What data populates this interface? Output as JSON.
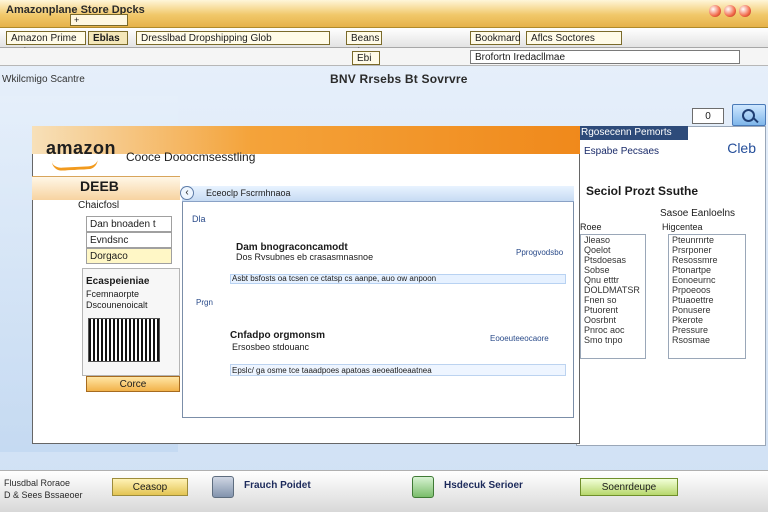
{
  "top": {
    "title": "Amazonplane Store Dpcks",
    "tabs_box": "+",
    "right_icons": [
      "close",
      "minimize",
      "maximize"
    ]
  },
  "toolbar": {
    "left_pill": "Amazon Prime Dok",
    "middle_pill": "Dresslbad Dropshipping Glob",
    "fb_pill": "Eblas",
    "status_pill": "Beans Sbout",
    "bookmark_pill": "Bookmard",
    "right_text": "Aflcs Soctores"
  },
  "address": {
    "label": "Ebi",
    "input_value": "Brofortn Iredacllmae"
  },
  "left": {
    "sidebar_label": "Wkilcmigo Scantre"
  },
  "headline": {
    "text": "BNV Rrsebs Bt Sovrvre"
  },
  "amazon": {
    "logo": "amazon",
    "tagline": "Cooce Dooocmsesstling",
    "section_label": "DEEB",
    "subtitle": "Chaicfosl",
    "field_1": "Dan bnoaden t",
    "field_2": "Evndsnc",
    "field_3": "Dorgaco",
    "card_title": "Ecaspeieniae",
    "card_line_1": "Fcemnaorpte",
    "card_line_2": "Dscounenoicalt",
    "card_btn": "Corce"
  },
  "popup": {
    "title": "Eceoclp Fscrmhnaoa",
    "left_mini": "Dla",
    "row_title": "Dam bnograconcamodt",
    "row_sub": "Dos Rvsubnes eb crasasmnasnoe",
    "row_text": "Asbt bsfosts oa tcsen ce ctatsp cs aanpe, auo ow anpoon",
    "row_note": "Pprogvodsbo",
    "side_label": "Prgn",
    "block2_title": "Cnfadpo orgmonsm",
    "block2_sub": "Ersosbeo stdouanc",
    "block2_row": "Epslc/ ga osme tce taaadpoes apatoas aeoeatloeaatnea",
    "row_note2": "Eooeuteeocaore"
  },
  "right": {
    "header": "Rgosecenn Pemorts",
    "title": "Espabe Pecsaes",
    "link": "Cleb",
    "section_title": "Seciol Prozt Ssuthe",
    "search_title": "Sasoe Eanloelns",
    "col_left_title": "Roee",
    "col_right_title": "Higcentea",
    "col_left_items": [
      "Jleaso",
      "Qoelot",
      "Ptsdoesas",
      "Sobse",
      "Qnu etttr",
      "DOLDMATSR",
      "Fnen so",
      "Ptuorent",
      "Oosrbnt",
      "Pnroc aoc",
      "Smo tnpo"
    ],
    "col_right_items": [
      "Pteunrnrte",
      "Prsrponer",
      "Resossmre",
      "Ptonartpe",
      "Eonoeurnc",
      "Prpoeoos",
      "Ptuaoettre",
      "Ponusere",
      "Pkerote",
      "Pressure",
      "Rsosmae"
    ]
  },
  "search": {
    "value": "0"
  },
  "bottom": {
    "left_line_1": "Flusdbal Roraoe",
    "left_line_2": "D & Sees Bssaeoer",
    "btn_left": "Ceasop",
    "label_1": "Frauch Poidet",
    "label_2": "Hsdecuk Serioer",
    "btn_right": "Soenrdeupe"
  }
}
